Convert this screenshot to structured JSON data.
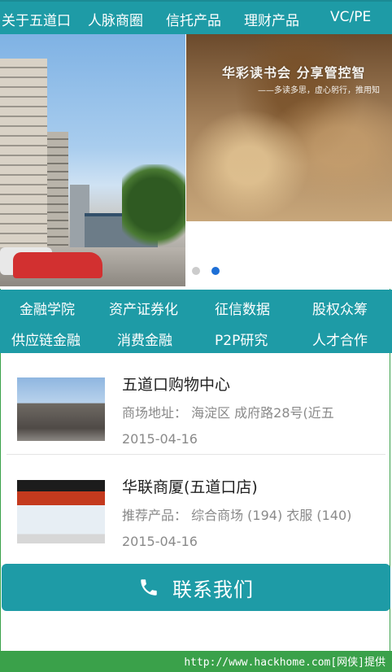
{
  "topnav": {
    "items": [
      "关于五道口",
      "人脉商圈",
      "信托产品",
      "理财产品",
      "VC/PE"
    ]
  },
  "banner": {
    "right_title": "华彩读书会  分享管控智",
    "right_subtitle": "——多读多思，虚心躬行，推用知",
    "active_dot": 2,
    "dot_count": 2
  },
  "menu": {
    "row1": [
      "金融学院",
      "资产证券化",
      "征信数据",
      "股权众筹"
    ],
    "row2": [
      "供应链金融",
      "消费金融",
      "P2P研究",
      "人才合作"
    ]
  },
  "list": [
    {
      "title": "五道口购物中心",
      "info": "商场地址：  海淀区 成府路28号(近五",
      "date": "2015-04-16"
    },
    {
      "title": "华联商厦(五道口店)",
      "info": "推荐产品：  综合商场 (194) 衣服 (140)",
      "date": "2015-04-16"
    }
  ],
  "contact": {
    "label": "联系我们"
  },
  "footer": {
    "watermark": "http://www.hackhome.com[网侠]提供"
  },
  "colors": {
    "teal": "#1e9ba6",
    "green": "#3aa14a",
    "dot_active": "#1e6fd6"
  }
}
